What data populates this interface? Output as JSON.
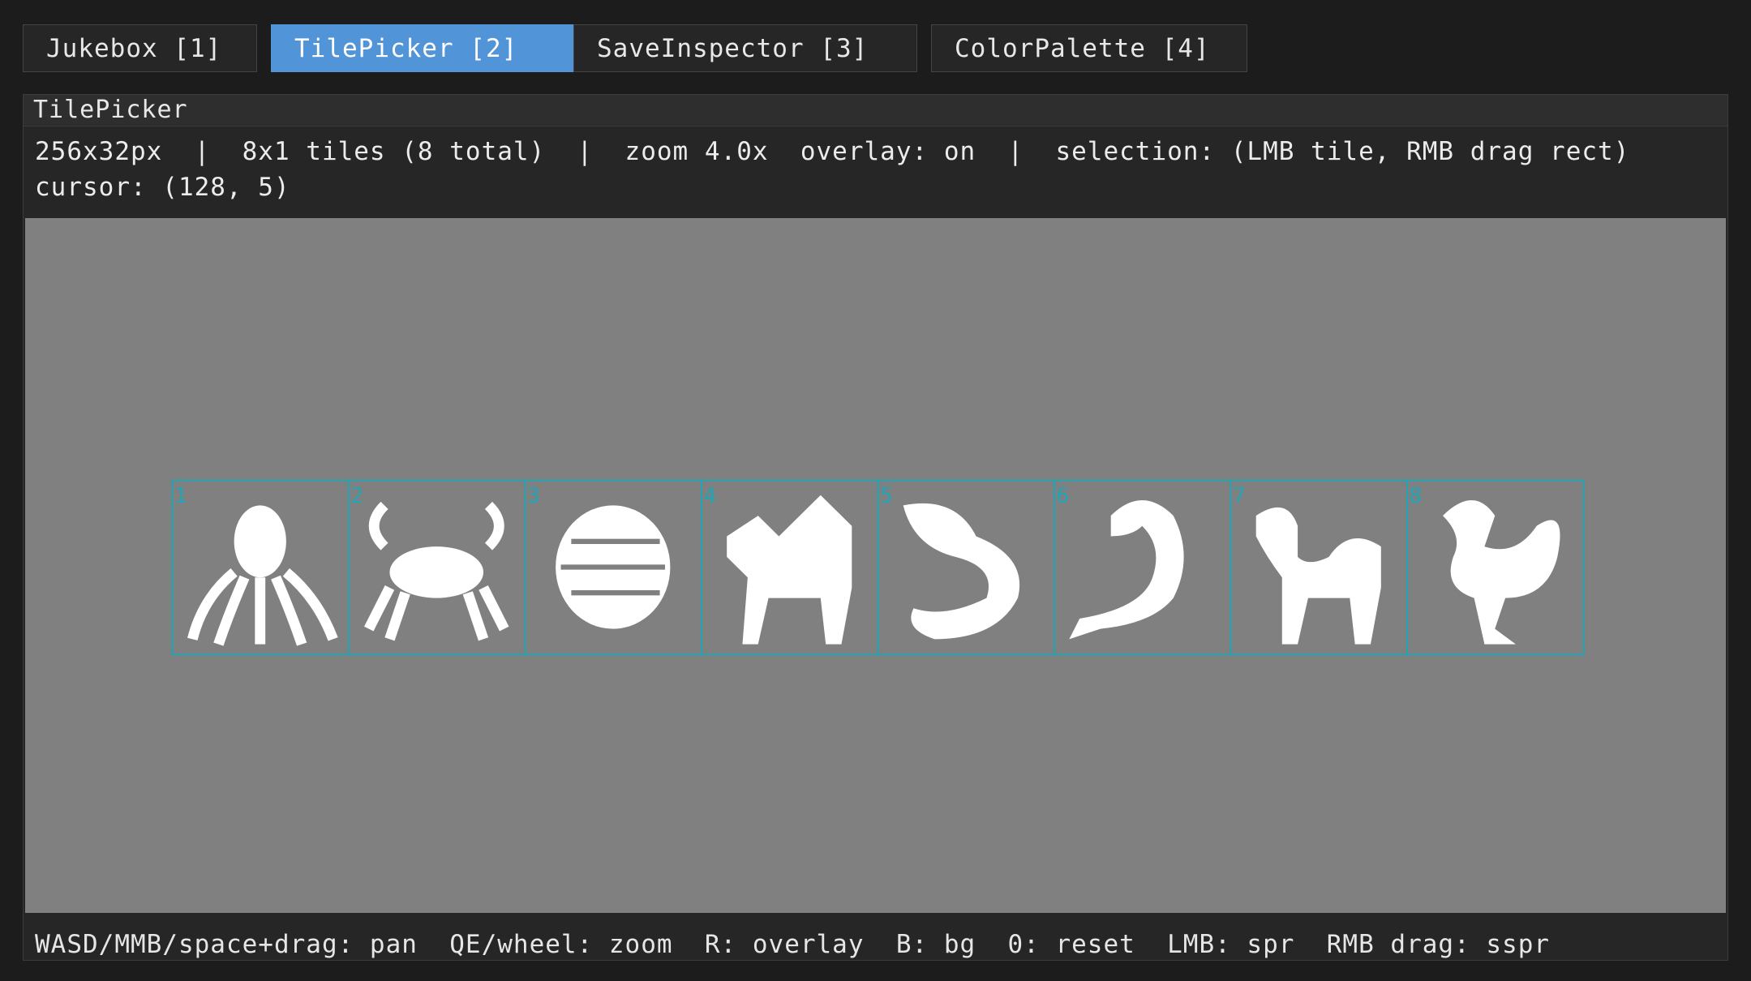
{
  "tabs": [
    {
      "label": "Jukebox [1]",
      "active": false
    },
    {
      "label": "TilePicker [2]",
      "active": true
    },
    {
      "label": "SaveInspector [3]",
      "active": false
    },
    {
      "label": "ColorPalette [4]",
      "active": false
    }
  ],
  "window": {
    "title": "TilePicker",
    "info_line1": "256x32px  |  8x1 tiles (8 total)  |  zoom 4.0x  overlay: on  |  selection: (LMB tile, RMB drag rect)",
    "info_line2": "cursor: (128, 5)"
  },
  "tiles": [
    {
      "index": "1",
      "icon": "octopus-sprite"
    },
    {
      "index": "2",
      "icon": "crab-sprite"
    },
    {
      "index": "3",
      "icon": "shell-sprite"
    },
    {
      "index": "4",
      "icon": "winged-lion-sprite"
    },
    {
      "index": "5",
      "icon": "lobster-sprite"
    },
    {
      "index": "6",
      "icon": "serpent-sprite"
    },
    {
      "index": "7",
      "icon": "camel-sprite"
    },
    {
      "index": "8",
      "icon": "bird-sprite"
    }
  ],
  "footer": "WASD/MMB/space+drag: pan  QE/wheel: zoom  R: overlay  B: bg  0: reset  LMB: spr  RMB drag: sspr",
  "colors": {
    "accent": "#5294d8",
    "overlay": "#1fa5b5",
    "canvas_bg": "#808080",
    "sprite": "#ffffff"
  }
}
